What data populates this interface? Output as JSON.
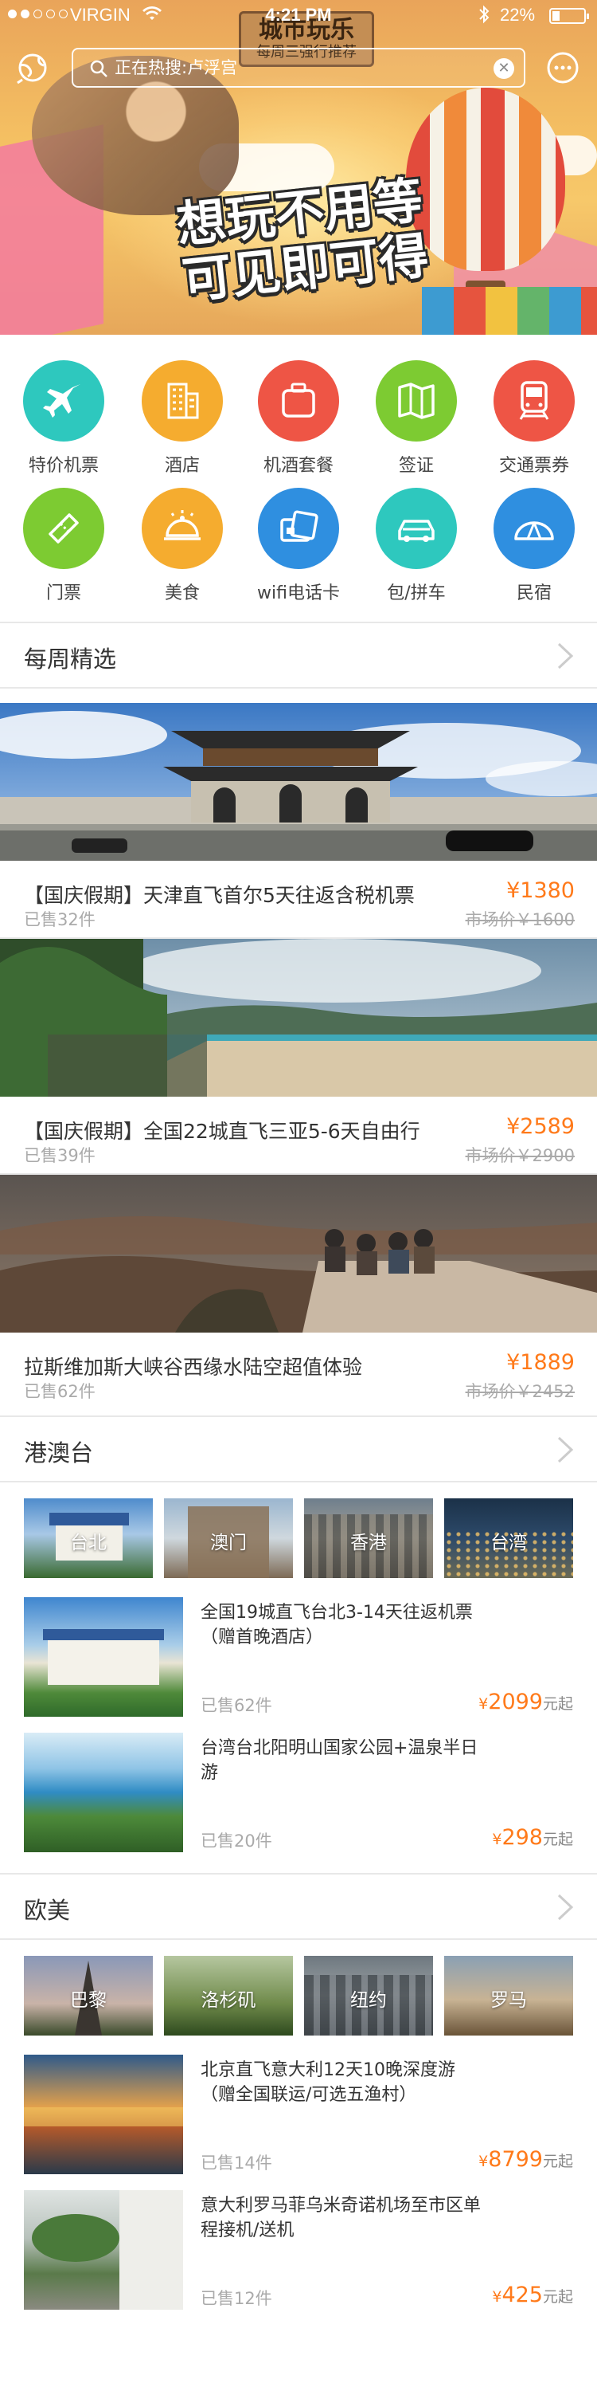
{
  "status_bar": {
    "carrier": "VIRGIN",
    "time": "4:21 PM",
    "battery": "22%"
  },
  "hero": {
    "board_title": "城市玩乐",
    "board_subtitle": "每周三强行推荐",
    "search_placeholder": "正在热搜:卢浮宫",
    "slogan_line1": "想玩不用等",
    "slogan_line2": "可见即可得"
  },
  "categories": [
    {
      "label": "特价机票",
      "icon": "airplane-icon",
      "color": "#2ec8be"
    },
    {
      "label": "酒店",
      "icon": "hotel-icon",
      "color": "#f5ac2f"
    },
    {
      "label": "机酒套餐",
      "icon": "suitcase-icon",
      "color": "#ee5545"
    },
    {
      "label": "签证",
      "icon": "map-icon",
      "color": "#7dcb32"
    },
    {
      "label": "交通票券",
      "icon": "train-icon",
      "color": "#ee5545"
    },
    {
      "label": "门票",
      "icon": "ticket-icon",
      "color": "#7dcb32"
    },
    {
      "label": "美食",
      "icon": "food-cloche-icon",
      "color": "#f5ac2f"
    },
    {
      "label": "wifi电话卡",
      "icon": "sim-card-icon",
      "color": "#2f8fe0"
    },
    {
      "label": "包/拼车",
      "icon": "car-icon",
      "color": "#2ec8be"
    },
    {
      "label": "民宿",
      "icon": "tent-icon",
      "color": "#2f8fe0"
    }
  ],
  "weekly": {
    "title": "每周精选",
    "items": [
      {
        "title": "【国庆假期】天津直飞首尔5天往返含税机票",
        "sold": "已售32件",
        "price": "¥1380",
        "market": "市场价￥1600"
      },
      {
        "title": "【国庆假期】全国22城直飞三亚5-6天自由行",
        "sold": "已售39件",
        "price": "¥2589",
        "market": "市场价￥2900"
      },
      {
        "title": "拉斯维加斯大峡谷西缘水陆空超值体验",
        "sold": "已售62件",
        "price": "¥1889",
        "market": "市场价￥2452"
      }
    ]
  },
  "hmt": {
    "title": "港澳台",
    "destinations": [
      "台北",
      "澳门",
      "香港",
      "台湾"
    ],
    "items": [
      {
        "title": "全国19城直飞台北3-14天往返机票（赠首晚酒店）",
        "sold": "已售62件",
        "price": "2099",
        "currency": "¥",
        "suffix": "元起"
      },
      {
        "title": "台湾台北阳明山国家公园+温泉半日游",
        "sold": "已售20件",
        "price": "298",
        "currency": "¥",
        "suffix": "元起"
      }
    ]
  },
  "western": {
    "title": "欧美",
    "destinations": [
      "巴黎",
      "洛杉矶",
      "纽约",
      "罗马"
    ],
    "items": [
      {
        "title": "北京直飞意大利12天10晚深度游（赠全国联运/可选五渔村）",
        "sold": "已售14件",
        "price": "8799",
        "currency": "¥",
        "suffix": "元起"
      },
      {
        "title": "意大利罗马菲乌米奇诺机场至市区单程接机/送机",
        "sold": "已售12件",
        "price": "425",
        "currency": "¥",
        "suffix": "元起"
      }
    ]
  }
}
